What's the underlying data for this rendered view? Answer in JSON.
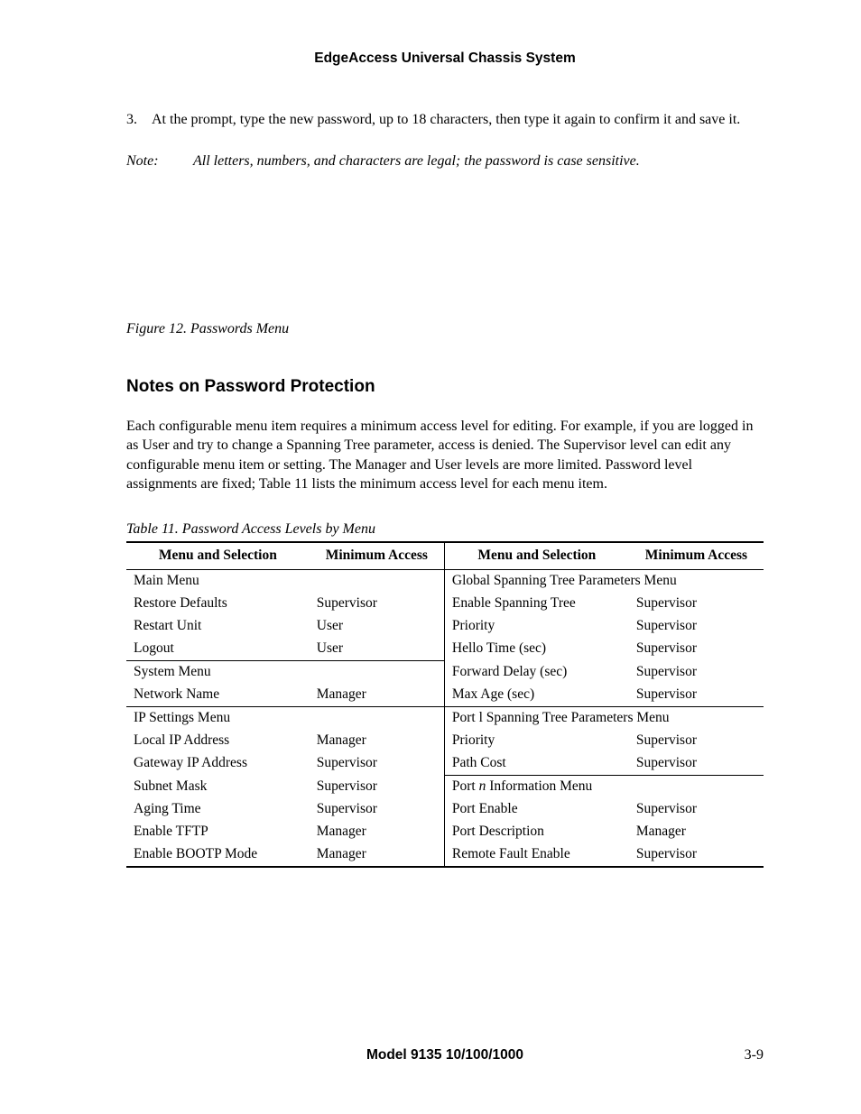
{
  "running_head": "EdgeAccess Universal Chassis System",
  "step": {
    "num": "3.",
    "text": "At the prompt, type the new password, up to 18 characters, then type it again to confirm it and save it."
  },
  "note": {
    "label": "Note:",
    "text": "All letters, numbers, and characters are legal; the password is case sensitive."
  },
  "figure_caption": "Figure 12.  Passwords Menu",
  "section_heading": "Notes on Password Protection",
  "section_body": "Each configurable menu item requires a minimum access level for editing.  For example, if you are logged in as User and try to change a Spanning Tree parameter, access is denied.  The Supervisor level can edit any configurable menu item or setting.  The Manager and User levels are more limited.  Password level assignments are fixed; Table 11 lists the minimum access level for each menu item.",
  "table_caption": "Table 11.  Password Access Levels by Menu",
  "table": {
    "headers": {
      "left_menu": "Menu  and Selection",
      "left_access": "Minimum Access",
      "right_menu": "Menu  and Selection",
      "right_access": "Minimum Access"
    },
    "rows": [
      {
        "section": true,
        "l_menu": "Main Menu",
        "l_access": "",
        "r_menu": "Global Spanning Tree Parameters Menu",
        "r_access": "",
        "r_span": true
      },
      {
        "l_menu": "Restore Defaults",
        "l_access": "Supervisor",
        "r_menu": "Enable Spanning Tree",
        "r_access": "Supervisor"
      },
      {
        "l_menu": "Restart Unit",
        "l_access": "User",
        "r_menu": "Priority",
        "r_access": "Supervisor"
      },
      {
        "l_menu": "Logout",
        "l_access": "User",
        "r_menu": "Hello Time (sec)",
        "r_access": "Supervisor"
      },
      {
        "section": "left",
        "l_menu": "System Menu",
        "l_access": "",
        "r_menu": "Forward Delay (sec)",
        "r_access": "Supervisor"
      },
      {
        "l_menu": "Network Name",
        "l_access": "Manager",
        "r_menu": "Max Age (sec)",
        "r_access": "Supervisor"
      },
      {
        "section": true,
        "l_menu": "IP Settings Menu",
        "l_access": "",
        "r_menu": "Port l Spanning Tree Parameters Menu",
        "r_access": "",
        "r_span": true
      },
      {
        "l_menu": "Local IP Address",
        "l_access": "Manager",
        "r_menu": "Priority",
        "r_access": "Supervisor"
      },
      {
        "l_menu": "Gateway IP Address",
        "l_access": "Supervisor",
        "r_menu": "Path Cost",
        "r_access": "Supervisor"
      },
      {
        "section": "right",
        "l_menu": "Subnet Mask",
        "l_access": "Supervisor",
        "r_menu_html": "Port <span class=\"port-n-ital\">n</span> Information Menu",
        "r_access": "",
        "r_span": true
      },
      {
        "l_menu": "Aging Time",
        "l_access": "Supervisor",
        "r_menu": "Port Enable",
        "r_access": "Supervisor"
      },
      {
        "l_menu": "Enable TFTP",
        "l_access": "Manager",
        "r_menu": "Port Description",
        "r_access": "Manager"
      },
      {
        "last": true,
        "l_menu": "Enable BOOTP Mode",
        "l_access": "Manager",
        "r_menu": "Remote Fault Enable",
        "r_access": "Supervisor"
      }
    ]
  },
  "footer": {
    "center": "Model 9135 10/100/1000",
    "right": "3-9"
  }
}
